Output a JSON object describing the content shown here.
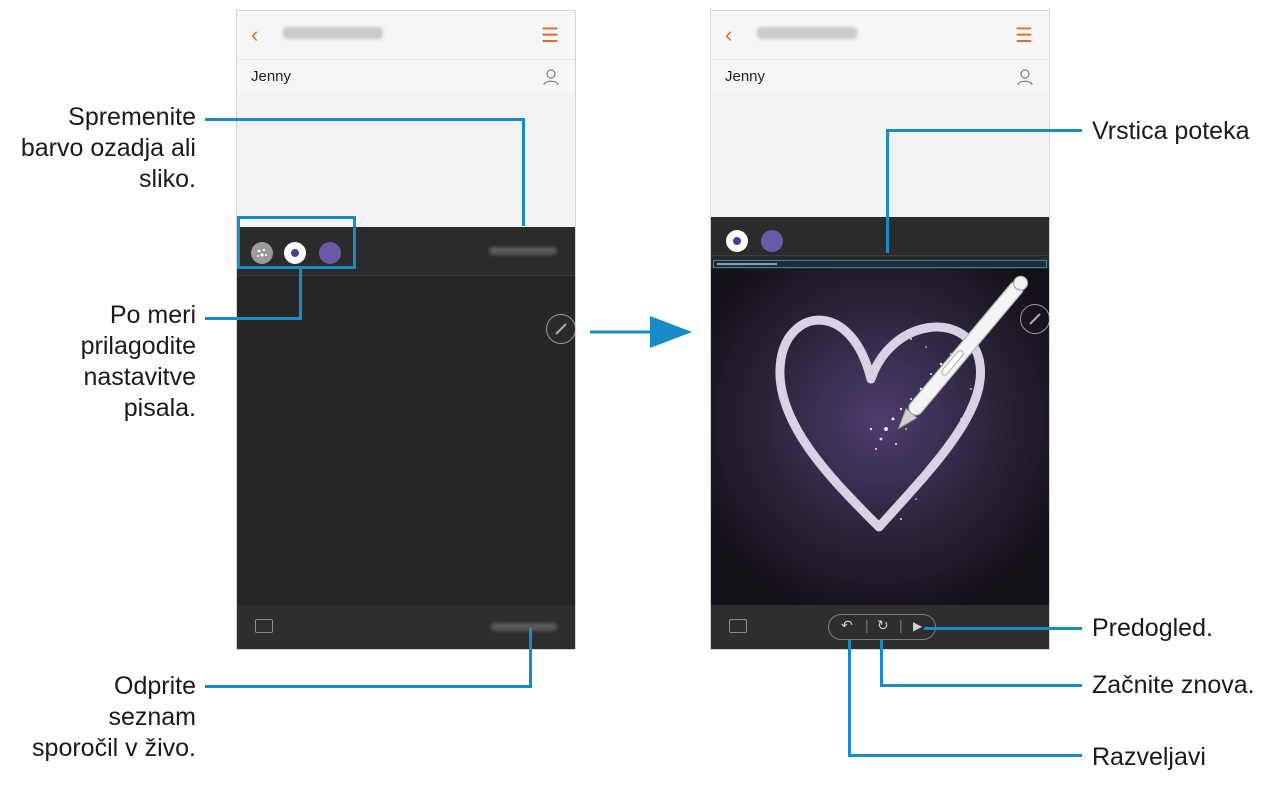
{
  "phone_left": {
    "recipient": "Jenny",
    "header_title_blurred": "NEW MESSAGE"
  },
  "phone_right": {
    "recipient": "Jenny",
    "header_title_blurred": "NEW MESSAGE"
  },
  "icons": {
    "back": "chevron-left-icon",
    "menu": "menu-icon",
    "person": "person-icon",
    "keyboard": "keyboard-icon",
    "pen": "pen-icon",
    "undo": "undo-icon",
    "restart": "restart-icon",
    "play": "play-icon"
  },
  "callouts": {
    "background": [
      "Spremenite",
      "barvo ozadja ali",
      "sliko."
    ],
    "pen_settings": [
      "Po meri",
      "prilagodite",
      "nastavitve",
      "pisala."
    ],
    "open_list": [
      "Odprite",
      "seznam",
      "sporočil v živo."
    ],
    "progress_bar": "Vrstica poteka",
    "preview": "Predogled.",
    "restart": "Začnite znova.",
    "undo": "Razveljavi"
  },
  "colors": {
    "accent_line": "#1a8bc9",
    "header_accent": "#e56b2b",
    "pen_purple": "#6b5aa8"
  }
}
